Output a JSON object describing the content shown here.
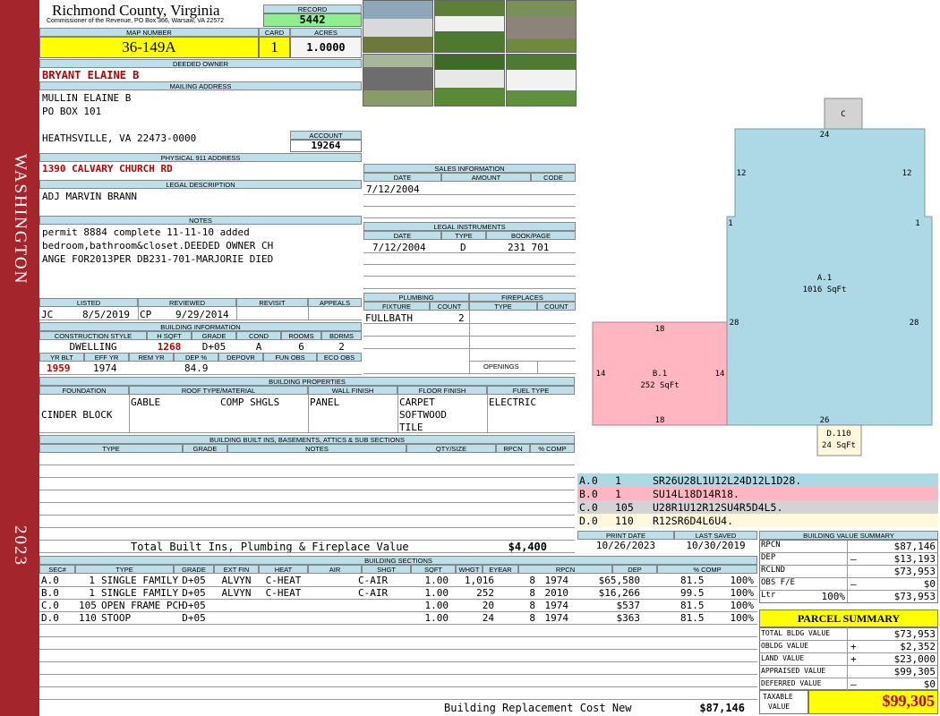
{
  "sidebar": {
    "district": "WASHINGTON",
    "year": "2023"
  },
  "header": {
    "county": "Richmond County, Virginia",
    "commissioner": "Commissioner of the Revenue, PO Box 366, Warsaw, VA 22572",
    "record_label": "RECORD",
    "record": "5442",
    "map_label": "MAP NUMBER",
    "map": "36-149A",
    "card_label": "CARD",
    "card": "1",
    "acres_label": "ACRES",
    "acres": "1.0000"
  },
  "owner": {
    "deeded_label": "DEEDED OWNER",
    "deeded": "BRYANT ELAINE B",
    "mailing_label": "MAILING ADDRESS",
    "mail1": "MULLIN ELAINE B",
    "mail2": "PO BOX 101",
    "mail3": "HEATHSVILLE, VA 22473-0000",
    "account_label": "ACCOUNT",
    "account": "19264",
    "phys_label": "PHYSICAL 911 ADDRESS",
    "phys": "1390 CALVARY CHURCH RD",
    "legal_label": "LEGAL DESCRIPTION",
    "legal": "ADJ MARVIN BRANN",
    "notes_label": "NOTES",
    "notes1": "permit 8884 complete 11-11-10 added",
    "notes2": "bedroom,bathroom&closet.DEEDED OWNER CH",
    "notes3": "ANGE FOR2013PER DB231-701-MARJORIE DIED"
  },
  "sales": {
    "label": "SALES INFORMATION",
    "h_date": "DATE",
    "h_amount": "AMOUNT",
    "h_code": "CODE",
    "date": "7/12/2004"
  },
  "legal_instruments": {
    "label": "LEGAL INSTRUMENTS",
    "h_date": "DATE",
    "h_type": "TYPE",
    "h_book": "BOOK/PAGE",
    "date": "7/12/2004",
    "type": "D",
    "book": "231 701"
  },
  "listing": {
    "h_listed": "LISTED",
    "h_reviewed": "REVIEWED",
    "h_revisit": "REVISIT",
    "h_appeals": "APPEALS",
    "listed_by": "JC",
    "listed": "8/5/2019",
    "reviewed_by": "CP",
    "reviewed": "9/29/2014"
  },
  "building_info": {
    "label": "BUILDING INFORMATION",
    "h_cs": "CONSTRUCTION STYLE",
    "h_hsqft": "H SQFT",
    "h_grade": "GRADE",
    "h_cond": "COND",
    "h_rooms": "ROOMS",
    "h_bdrms": "BDRMS",
    "cs": "DWELLING",
    "hsqft": "1268",
    "grade": "D+05",
    "cond": "A",
    "rooms": "6",
    "bdrms": "2",
    "h_yrblt": "YR BLT",
    "h_effyr": "EFF YR",
    "h_remyr": "REM YR",
    "h_dep": "DEP %",
    "h_depovr": "DEPOVR",
    "h_funobs": "FUN OBS",
    "h_ecoobs": "ECO OBS",
    "yrblt": "1959",
    "effyr": "1974",
    "dep": "84.9"
  },
  "plumbing": {
    "label": "PLUMBING",
    "h_fixture": "FIXTURE",
    "h_count": "COUNT",
    "fixture": "FULLBATH",
    "count": "2"
  },
  "fireplaces": {
    "label": "FIREPLACES",
    "h_type": "TYPE",
    "h_count": "COUNT",
    "openings": "OPENINGS"
  },
  "props": {
    "label": "BUILDING PROPERTIES",
    "h_found": "FOUNDATION",
    "h_roof": "ROOF TYPE/MATERIAL",
    "h_wall": "WALL FINISH",
    "h_floor": "FLOOR FINISH",
    "h_fuel": "FUEL TYPE",
    "found": "CINDER BLOCK",
    "roof1": "GABLE",
    "roof2": "COMP SHGLS",
    "wall": "PANEL",
    "floor1": "CARPET",
    "floor2": "SOFTWOOD",
    "floor3": "TILE",
    "fuel": "ELECTRIC"
  },
  "builtins": {
    "label": "BUILDING BUILT INS, BASEMENTS, ATTICS & SUB SECTIONS",
    "h_type": "TYPE",
    "h_grade": "GRADE",
    "h_notes": "NOTES",
    "h_qty": "QTY/SIZE",
    "h_rpcn": "RPCN",
    "h_comp": "% COMP",
    "total_label": "Total Built Ins, Plumbing & Fireplace Value",
    "total": "$4,400"
  },
  "print": {
    "h_print": "PRINT DATE",
    "h_saved": "LAST SAVED",
    "print": "10/26/2023",
    "saved": "10/30/2019"
  },
  "sections": {
    "label": "BUILDING SECTIONS",
    "headers": [
      "SEC#",
      "TYPE",
      "GRADE",
      "EXT FIN",
      "HEAT",
      "AIR",
      "SHGT",
      "SQFT",
      "WHGT",
      "EYEAR",
      "RPCN",
      "DEP",
      "% COMP"
    ],
    "rows": [
      {
        "sec": "A.0",
        "code": "1",
        "type": "SINGLE FAMILY",
        "grade": "D+05",
        "ext": "ALVYN",
        "heat": "C-HEAT",
        "air": "C-AIR",
        "shgt": "1.00",
        "sqft": "1,016",
        "whgt": "8",
        "eyear": "1974",
        "rpcn": "$65,580",
        "dep": "81.5",
        "comp": "100%"
      },
      {
        "sec": "B.0",
        "code": "1",
        "type": "SINGLE FAMILY",
        "grade": "D+05",
        "ext": "ALVYN",
        "heat": "C-HEAT",
        "air": "C-AIR",
        "shgt": "1.00",
        "sqft": "252",
        "whgt": "8",
        "eyear": "2010",
        "rpcn": "$16,266",
        "dep": "99.5",
        "comp": "100%"
      },
      {
        "sec": "C.0",
        "code": "105",
        "type": "OPEN FRAME PCH",
        "grade": "D+05",
        "ext": "",
        "heat": "",
        "air": "",
        "shgt": "1.00",
        "sqft": "20",
        "whgt": "8",
        "eyear": "1974",
        "rpcn": "$537",
        "dep": "81.5",
        "comp": "100%"
      },
      {
        "sec": "D.0",
        "code": "110",
        "type": "STOOP",
        "grade": "D+05",
        "ext": "",
        "heat": "",
        "air": "",
        "shgt": "1.00",
        "sqft": "24",
        "whgt": "8",
        "eyear": "1974",
        "rpcn": "$363",
        "dep": "81.5",
        "comp": "100%"
      }
    ],
    "brcn_label": "Building Replacement Cost New",
    "brcn": "$87,146"
  },
  "sketch": {
    "a_label": "A.1",
    "a_area": "1016 SqFt",
    "b_label": "B.1",
    "b_area": "252 SqFt",
    "c_label": "C",
    "d_label": "D.110",
    "d_area": "24 SqFt",
    "dims": {
      "a_top": "24",
      "a_left": "12",
      "a_right": "12",
      "a_lstep": "1",
      "a_rstep": "1",
      "a_lside": "28",
      "a_rside": "28",
      "a_bottom": "26",
      "b_top": "18",
      "b_left": "14",
      "b_right": "14",
      "b_bottom": "18"
    },
    "colors": {
      "a": "#add8e6",
      "b": "#ffb6c1",
      "c": "#d3d3d3",
      "d": "#fff8dc"
    },
    "codes": [
      {
        "sec": "A.0",
        "code": "1",
        "desc": "SR26U28L1U12L24D12L1D28.",
        "color": "#add8e6"
      },
      {
        "sec": "B.0",
        "code": "1",
        "desc": "SU14L18D14R18.",
        "color": "#ffb6c1"
      },
      {
        "sec": "C.0",
        "code": "105",
        "desc": "U28R1U12R12SU4R5D4L5.",
        "color": "#d3d3d3"
      },
      {
        "sec": "D.0",
        "code": "110",
        "desc": "R12SR6D4L6U4.",
        "color": "#fff8dc"
      }
    ]
  },
  "bvs": {
    "label": "BUILDING VALUE SUMMARY",
    "rpcn_l": "RPCN",
    "rpcn": "$87,146",
    "dep_l": "DEP",
    "dep_s": "–",
    "dep": "$13,193",
    "rclnd_l": "RCLND",
    "rclnd": "$73,953",
    "obs_l": "OBS F/E",
    "obs_s": "–",
    "obs": "$0",
    "ltr_l": "Ltr",
    "ltr_p": "100%",
    "ltr": "$73,953"
  },
  "parcel": {
    "label": "PARCEL SUMMARY",
    "tbv_l": "TOTAL BLDG VALUE",
    "tbv": "$73,953",
    "oblg_l": "OBLDG VALUE",
    "oblg_s": "+",
    "oblg": "$2,352",
    "land_l": "LAND VALUE",
    "land_s": "+",
    "land": "$23,000",
    "appr_l": "APPRAISED VALUE",
    "appr": "$99,305",
    "def_l": "DEFERRED VALUE",
    "def_s": "–",
    "def": "$0",
    "tax_l1": "TAXABLE",
    "tax_l2": "VALUE",
    "tax": "$99,305"
  }
}
